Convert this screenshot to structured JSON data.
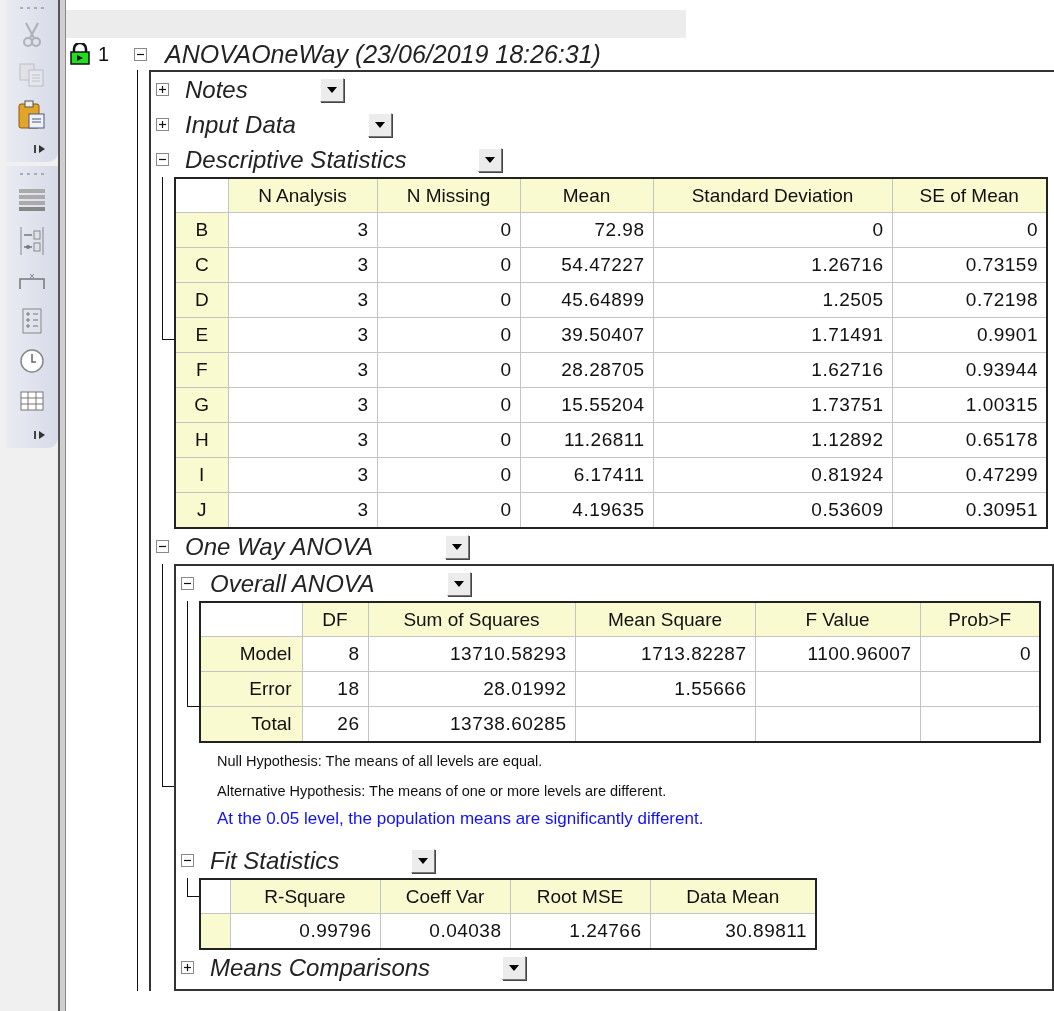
{
  "toolbar": {
    "groups": [
      {
        "items": [
          {
            "disabled": true
          },
          {
            "disabled": true
          },
          {
            "disabled": false
          }
        ]
      },
      {
        "items": [
          {
            "disabled": false
          },
          {
            "disabled": false
          },
          {
            "disabled": false
          },
          {
            "disabled": false
          },
          {
            "disabled": false
          },
          {
            "disabled": false
          }
        ]
      }
    ]
  },
  "report": {
    "index": "1",
    "title": "ANOVAOneWay (23/06/2019 18:26:31)",
    "expanded": true,
    "sections": [
      {
        "title": "Notes",
        "expanded": false
      },
      {
        "title": "Input Data",
        "expanded": false
      },
      {
        "title": "Descriptive Statistics",
        "expanded": true,
        "table": {
          "kind": "descriptive",
          "columns": [
            "N Analysis",
            "N Missing",
            "Mean",
            "Standard Deviation",
            "SE of Mean"
          ],
          "rows": [
            {
              "label": "B",
              "cells": [
                "3",
                "0",
                "72.98",
                "0",
                "0"
              ]
            },
            {
              "label": "C",
              "cells": [
                "3",
                "0",
                "54.47227",
                "1.26716",
                "0.73159"
              ]
            },
            {
              "label": "D",
              "cells": [
                "3",
                "0",
                "45.64899",
                "1.2505",
                "0.72198"
              ]
            },
            {
              "label": "E",
              "cells": [
                "3",
                "0",
                "39.50407",
                "1.71491",
                "0.9901"
              ]
            },
            {
              "label": "F",
              "cells": [
                "3",
                "0",
                "28.28705",
                "1.62716",
                "0.93944"
              ]
            },
            {
              "label": "G",
              "cells": [
                "3",
                "0",
                "15.55204",
                "1.73751",
                "1.00315"
              ]
            },
            {
              "label": "H",
              "cells": [
                "3",
                "0",
                "11.26811",
                "1.12892",
                "0.65178"
              ]
            },
            {
              "label": "I",
              "cells": [
                "3",
                "0",
                "6.17411",
                "0.81924",
                "0.47299"
              ]
            },
            {
              "label": "J",
              "cells": [
                "3",
                "0",
                "4.19635",
                "0.53609",
                "0.30951"
              ]
            }
          ]
        }
      },
      {
        "title": "One Way ANOVA",
        "expanded": true,
        "items": [
          {
            "kind": "section",
            "title": "Overall ANOVA",
            "expanded": true,
            "table": {
              "kind": "anova",
              "columns": [
                "DF",
                "Sum of Squares",
                "Mean Square",
                "F Value",
                "Prob>F"
              ],
              "rows": [
                {
                  "label": "Model",
                  "cells": [
                    "8",
                    "13710.58293",
                    "1713.82287",
                    "1100.96007",
                    "0"
                  ]
                },
                {
                  "label": "Error",
                  "cells": [
                    "18",
                    "28.01992",
                    "1.55666",
                    null,
                    null
                  ]
                },
                {
                  "label": "Total",
                  "cells": [
                    "26",
                    "13738.60285",
                    null,
                    null,
                    null
                  ]
                }
              ]
            }
          },
          {
            "kind": "note",
            "text": "Null Hypothesis: The means of all levels are equal."
          },
          {
            "kind": "note",
            "text": "Alternative Hypothesis: The means of one or more levels are different."
          },
          {
            "kind": "conclusion",
            "text": "At the 0.05 level, the population means are significantly different."
          },
          {
            "kind": "section",
            "title": "Fit Statistics",
            "expanded": true,
            "table": {
              "kind": "fit",
              "columns": [
                "R-Square",
                "Coeff Var",
                "Root MSE",
                "Data Mean"
              ],
              "rows": [
                {
                  "cells": [
                    "0.99796",
                    "0.04038",
                    "1.24766",
                    "30.89811"
                  ]
                }
              ]
            }
          },
          {
            "kind": "section",
            "title": "Means Comparisons",
            "expanded": false
          }
        ]
      }
    ]
  }
}
